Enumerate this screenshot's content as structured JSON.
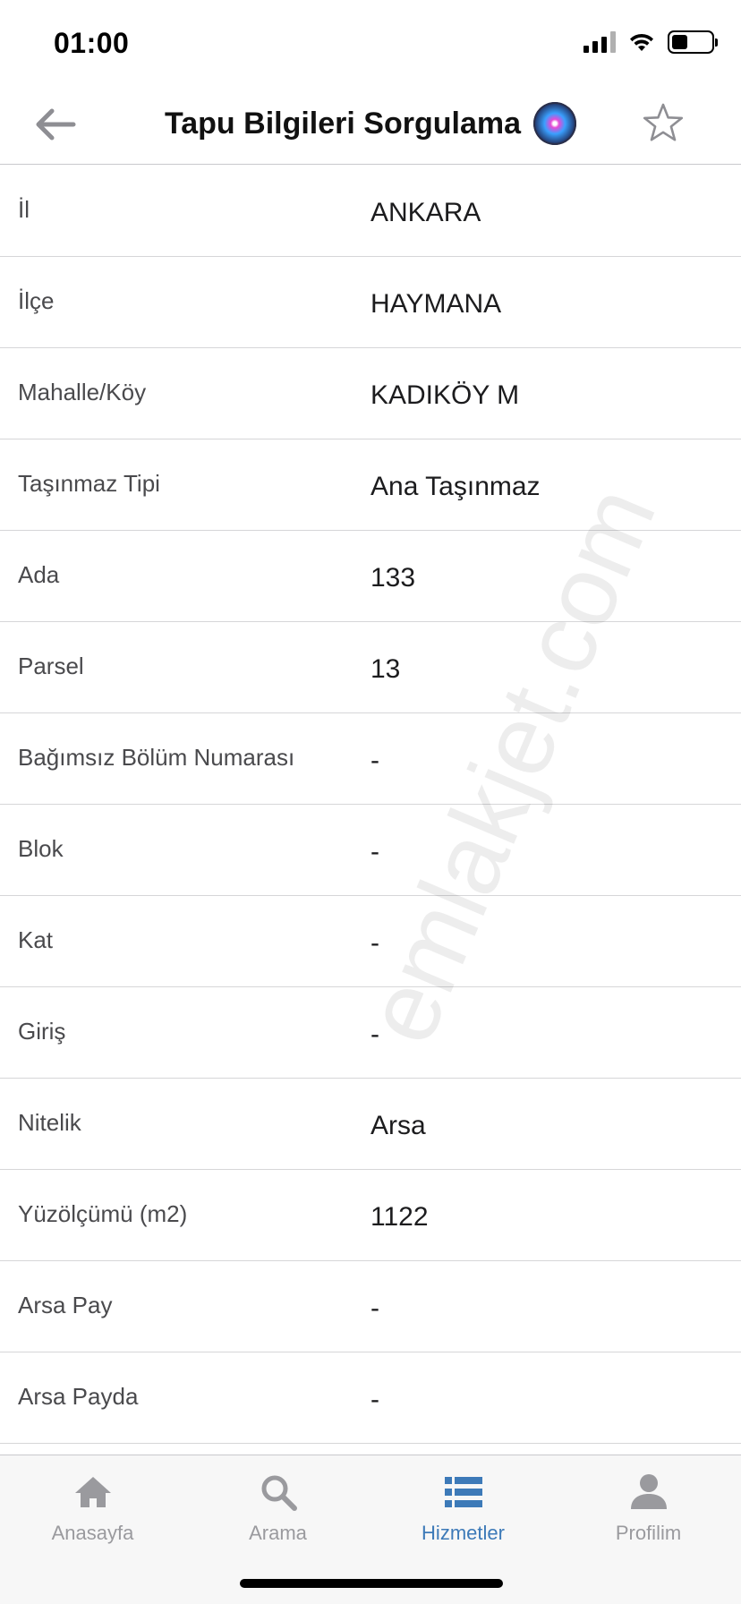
{
  "status_bar": {
    "time": "01:00",
    "battery_level": 0.4
  },
  "header": {
    "title": "Tapu Bilgileri Sorgulama",
    "back_icon": "arrow-left-icon",
    "favorite_icon": "star-outline-icon",
    "assistant_icon": "siri-icon"
  },
  "rows": [
    {
      "label": "İl",
      "value": "ANKARA"
    },
    {
      "label": "İlçe",
      "value": "HAYMANA"
    },
    {
      "label": "Mahalle/Köy",
      "value": "KADIKÖY M"
    },
    {
      "label": "Taşınmaz Tipi",
      "value": "Ana Taşınmaz"
    },
    {
      "label": "Ada",
      "value": "133"
    },
    {
      "label": "Parsel",
      "value": "13"
    },
    {
      "label": "Bağımsız Bölüm Numarası",
      "value": "-"
    },
    {
      "label": "Blok",
      "value": "-"
    },
    {
      "label": "Kat",
      "value": "-"
    },
    {
      "label": "Giriş",
      "value": "-"
    },
    {
      "label": "Nitelik",
      "value": "Arsa"
    },
    {
      "label": "Yüzölçümü (m2)",
      "value": "1122"
    },
    {
      "label": "Arsa Pay",
      "value": "-"
    },
    {
      "label": "Arsa Payda",
      "value": "-"
    }
  ],
  "watermark": "emlakjet.com",
  "tabs": [
    {
      "label": "Anasayfa",
      "icon": "home-icon",
      "active": false
    },
    {
      "label": "Arama",
      "icon": "search-icon",
      "active": false
    },
    {
      "label": "Hizmetler",
      "icon": "list-icon",
      "active": true
    },
    {
      "label": "Profilim",
      "icon": "person-icon",
      "active": false
    }
  ],
  "colors": {
    "active_tab": "#3d7ab8",
    "inactive_tab": "#9a9a9e",
    "divider": "#d6d6d8"
  }
}
